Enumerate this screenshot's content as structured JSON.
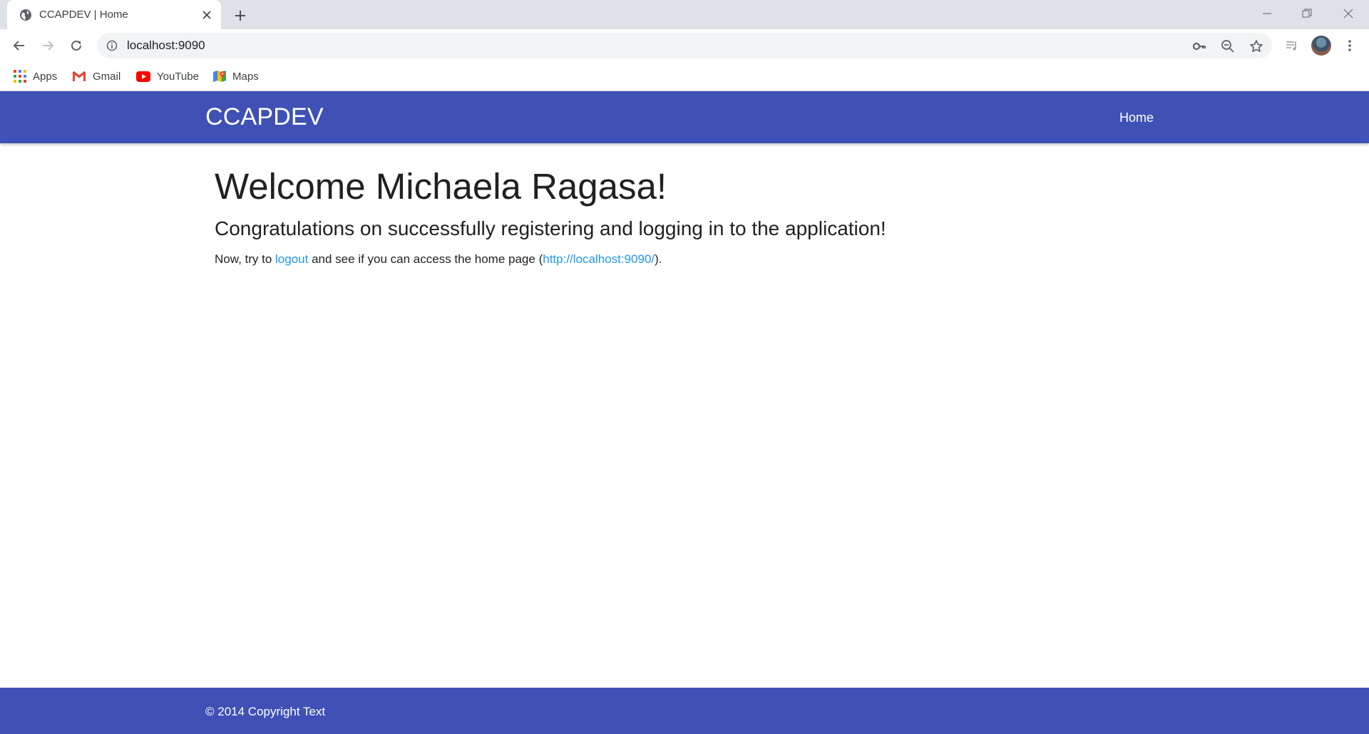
{
  "browser": {
    "tab": {
      "title": "CCAPDEV | Home"
    },
    "address_bar": {
      "url": "localhost:9090"
    },
    "bookmarks": [
      {
        "label": "Apps"
      },
      {
        "label": "Gmail"
      },
      {
        "label": "YouTube"
      },
      {
        "label": "Maps"
      }
    ]
  },
  "navbar": {
    "brand": "CCAPDEV",
    "links": [
      {
        "label": "Home"
      }
    ]
  },
  "main": {
    "heading_prefix": "Welcome ",
    "user_name": "Michaela Ragasa",
    "heading_suffix": "!",
    "subheading": "Congratulations on successfully registering and logging in to the application!",
    "instruction": {
      "before_link": "Now, try to ",
      "logout_link": "logout",
      "middle": " and see if you can access the home page (",
      "home_link": "http://localhost:9090/",
      "after_link": ")."
    }
  },
  "footer": {
    "text": "© 2014 Copyright Text"
  },
  "colors": {
    "navbar_bg": "#3f51b5",
    "link": "#2196f3",
    "tabstrip_bg": "#dee1e6"
  }
}
